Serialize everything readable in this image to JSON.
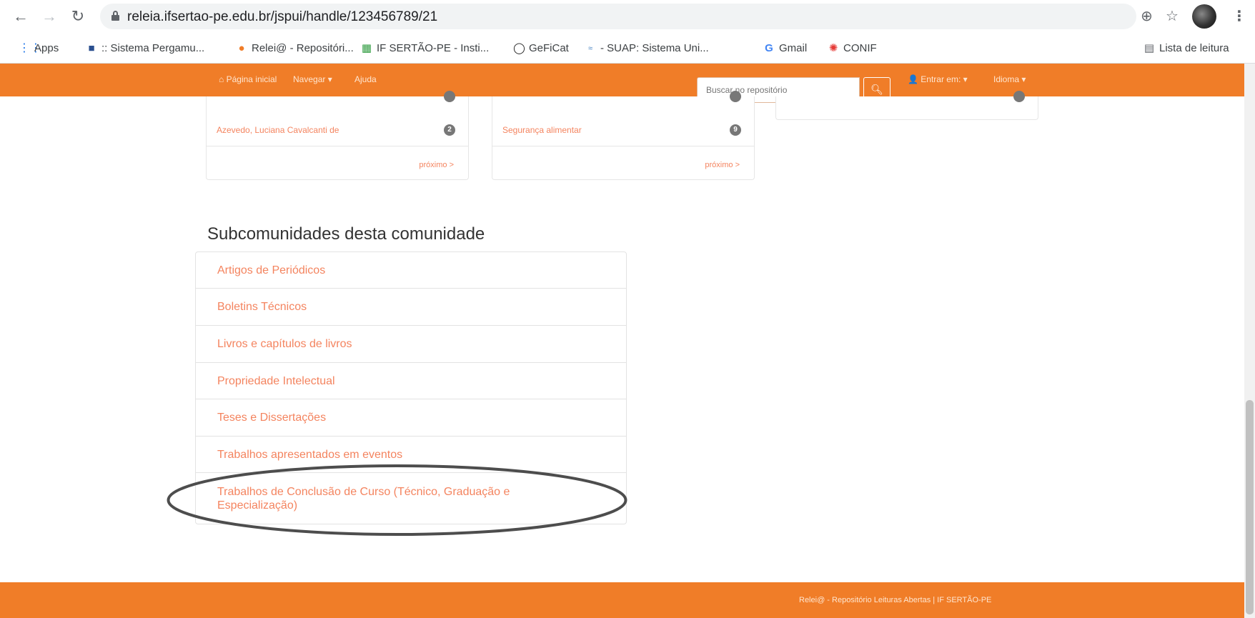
{
  "browser": {
    "url": "releia.ifsertao-pe.edu.br/jspui/handle/123456789/21",
    "bookmarks": [
      {
        "label": "Apps",
        "icon": "apps-grid-icon"
      },
      {
        "label": ":: Sistema Pergamu...",
        "icon": "pergamum-icon"
      },
      {
        "label": "Relei@ - Repositóri...",
        "icon": "releia-icon"
      },
      {
        "label": "IF SERTÃO-PE - Insti...",
        "icon": "if-sertao-icon"
      },
      {
        "label": "GeFiCat",
        "icon": "geficat-icon"
      },
      {
        "label": "- SUAP: Sistema Uni...",
        "icon": "suap-icon"
      },
      {
        "label": "Gmail",
        "icon": "google-icon"
      },
      {
        "label": "CONIF",
        "icon": "conif-icon"
      }
    ],
    "reading_list": "Lista de leitura"
  },
  "navbar": {
    "home": "Página inicial",
    "browse": "Navegar",
    "help": "Ajuda",
    "search_placeholder": "Buscar no repositório",
    "login": "Entrar em:",
    "language": "Idioma"
  },
  "cards": {
    "authors": {
      "item": "Azevedo, Luciana Cavalcanti de",
      "count": "2",
      "next": "próximo >"
    },
    "subjects": {
      "item": "Segurança alimentar",
      "count": "9",
      "next": "próximo >"
    }
  },
  "subcommunities": {
    "title": "Subcomunidades desta comunidade",
    "items": [
      "Artigos de Periódicos",
      "Boletins Técnicos",
      "Livros e capítulos de livros",
      "Propriedade Intelectual",
      "Teses e Dissertações",
      "Trabalhos apresentados em eventos",
      "Trabalhos de Conclusão de Curso (Técnico, Graduação e Especialização)"
    ]
  },
  "footer": {
    "text": "Relei@ - Repositório Leituras Abertas | IF SERTÃO-PE"
  },
  "colors": {
    "brand_orange": "#f07d28",
    "link": "#f4845f",
    "annotation": "#4d4d4d"
  }
}
